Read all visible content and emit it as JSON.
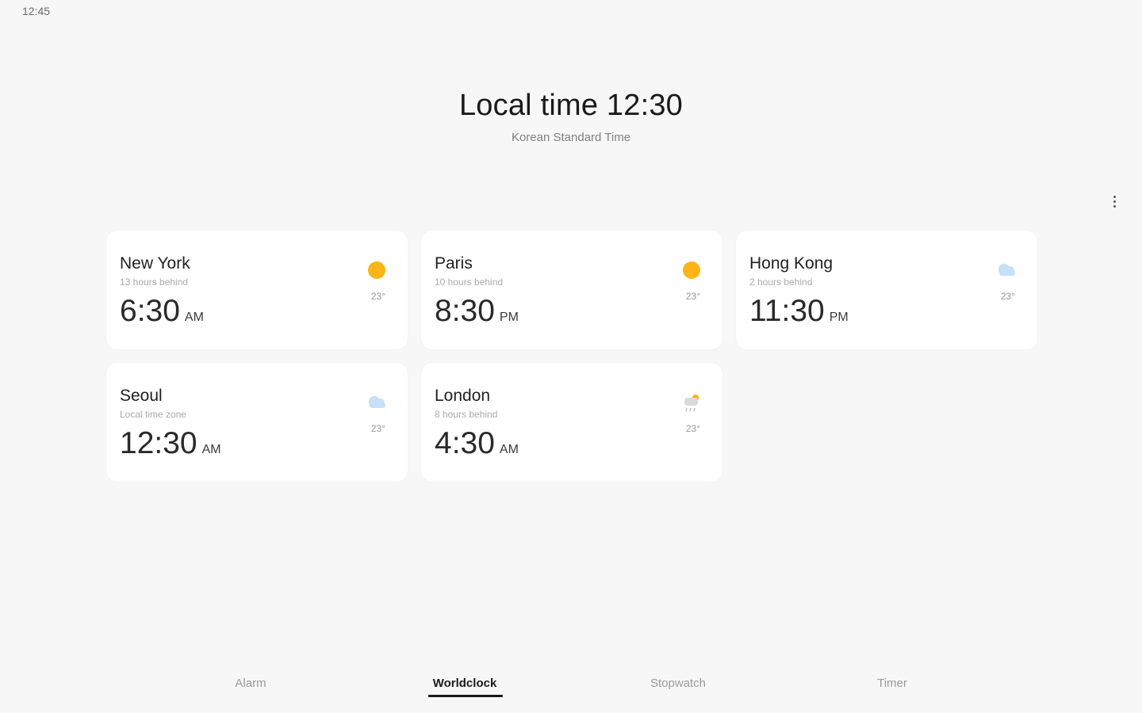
{
  "status_bar": {
    "time": "12:45"
  },
  "header": {
    "title": "Local time 12:30",
    "subtitle": "Korean Standard Time"
  },
  "colors": {
    "sun": "#FDB515",
    "cloud": "#C7DFF7",
    "background": "#F7F7F7",
    "card": "#FFFFFF"
  },
  "cards": [
    {
      "city": "New York",
      "diff": "13 hours behind",
      "time": "6:30",
      "ampm": "AM",
      "weather_icon": "sun-icon",
      "temp": "23°"
    },
    {
      "city": "Paris",
      "diff": "10 hours behind",
      "time": "8:30",
      "ampm": "PM",
      "weather_icon": "sun-icon",
      "temp": "23°"
    },
    {
      "city": "Hong Kong",
      "diff": "2 hours behind",
      "time": "11:30",
      "ampm": "PM",
      "weather_icon": "cloud-icon",
      "temp": "23°"
    },
    {
      "city": "Seoul",
      "diff": "Local time zone",
      "time": "12:30",
      "ampm": "AM",
      "weather_icon": "cloud-icon",
      "temp": "23°"
    },
    {
      "city": "London",
      "diff": "8 hours behind",
      "time": "4:30",
      "ampm": "AM",
      "weather_icon": "rain-sun-icon",
      "temp": "23°"
    }
  ],
  "tabs": [
    {
      "label": "Alarm",
      "active": false
    },
    {
      "label": "Worldclock",
      "active": true
    },
    {
      "label": "Stopwatch",
      "active": false
    },
    {
      "label": "Timer",
      "active": false
    }
  ]
}
